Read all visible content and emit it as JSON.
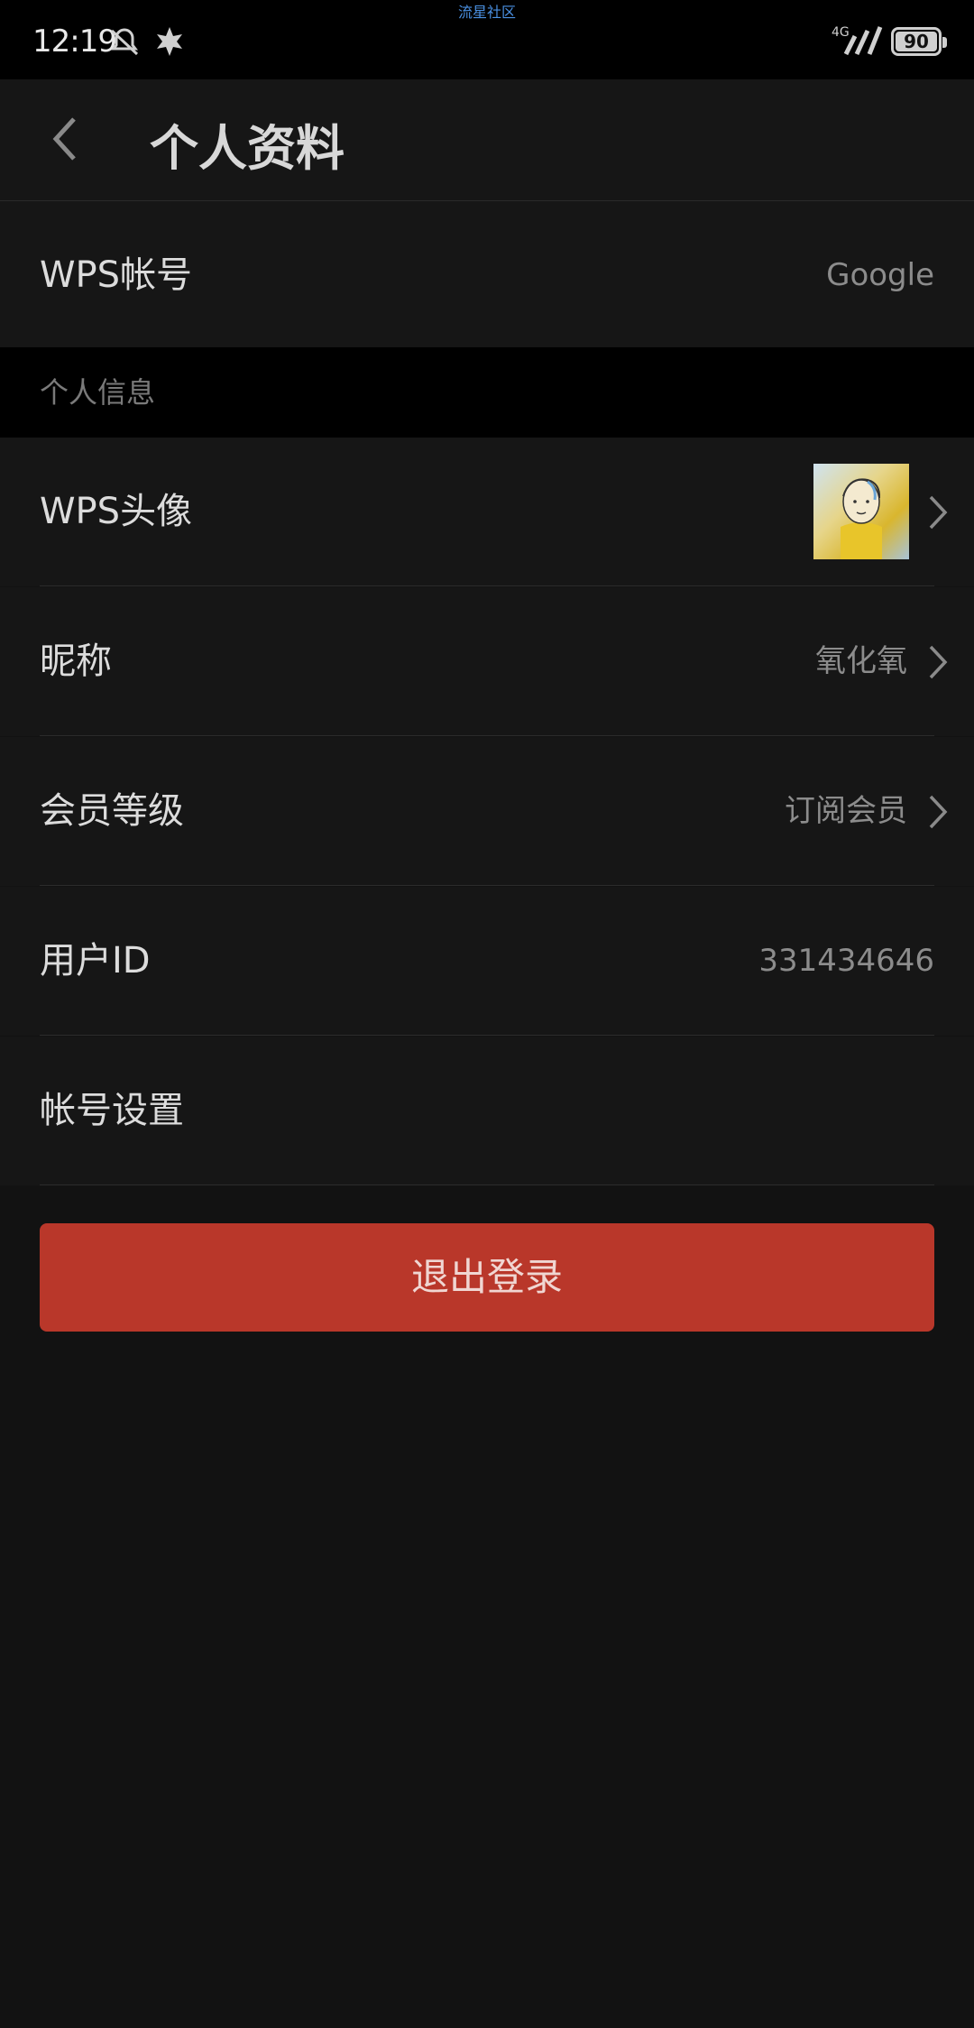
{
  "status_bar": {
    "time": "12:19",
    "top_label": "流星社区",
    "network": "4G",
    "battery": "90"
  },
  "header": {
    "title": "个人资料"
  },
  "wps_account": {
    "label": "WPS帐号",
    "value": "Google"
  },
  "section_personal": {
    "title": "个人信息"
  },
  "rows": {
    "avatar": {
      "label": "WPS头像"
    },
    "nickname": {
      "label": "昵称",
      "value": "氧化氧"
    },
    "membership": {
      "label": "会员等级",
      "value": "订阅会员"
    },
    "user_id": {
      "label": "用户ID",
      "value": "331434646"
    },
    "account_settings": {
      "label": "帐号设置"
    }
  },
  "logout": {
    "label": "退出登录"
  },
  "colors": {
    "background": "#121212",
    "row_background": "#161616",
    "logout_button": "#b9372a"
  }
}
